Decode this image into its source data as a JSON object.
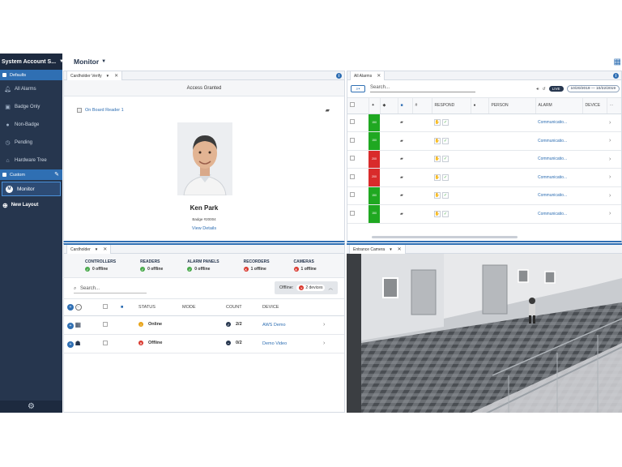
{
  "sidebar": {
    "account": "System Account S...",
    "defaults_label": "Defaults",
    "items": [
      {
        "label": "All Alarms",
        "icon": "bell-icon"
      },
      {
        "label": "Badge Only",
        "icon": "badge-icon"
      },
      {
        "label": "Non-Badge",
        "icon": "person-icon"
      },
      {
        "label": "Pending",
        "icon": "clock-icon"
      },
      {
        "label": "Hardware Tree",
        "icon": "tree-icon"
      }
    ],
    "custom_label": "Custom",
    "monitor_label": "Monitor",
    "new_layout_label": "New Layout"
  },
  "header": {
    "title": "Monitor"
  },
  "cardholder_verify": {
    "tab": "Cardholder Verify",
    "status": "Access Granted",
    "reader": "On Board Reader 1",
    "name": "Ken Park",
    "badge": "Badge #20004",
    "view_details": "View Details"
  },
  "alarms": {
    "tab": "All Alarms",
    "search_placeholder": "Search...",
    "live": "LIVE",
    "date_range": "10/20/2019 — 10/22/2019",
    "columns": [
      "",
      "",
      "",
      "",
      "#",
      "RESPOND",
      "",
      "PERSON",
      "ALARM",
      "DEVICE"
    ],
    "rows": [
      {
        "priority": "150",
        "color": "#1fa821",
        "alarm": "Communicatio..."
      },
      {
        "priority": "150",
        "color": "#1fa821",
        "alarm": "Communicatio..."
      },
      {
        "priority": "200",
        "color": "#d92b2b",
        "alarm": "Communicatio..."
      },
      {
        "priority": "200",
        "color": "#d92b2b",
        "alarm": "Communicatio..."
      },
      {
        "priority": "150",
        "color": "#1fa821",
        "alarm": "Communicatio..."
      },
      {
        "priority": "150",
        "color": "#1fa821",
        "alarm": "Communicatio..."
      }
    ]
  },
  "cardholder": {
    "tab": "Cardholder",
    "stats": [
      {
        "label": "CONTROLLERS",
        "value": "0 offline",
        "state": "ok"
      },
      {
        "label": "READERS",
        "value": "0 offline",
        "state": "ok"
      },
      {
        "label": "ALARM PANELS",
        "value": "0 offline",
        "state": "ok"
      },
      {
        "label": "RECORDERS",
        "value": "1 offline",
        "state": "bad"
      },
      {
        "label": "CAMERAS",
        "value": "1 offline",
        "state": "bad"
      }
    ],
    "search_placeholder": "Search...",
    "offline_label": "Offline:",
    "offline_count": "2 devices",
    "columns": {
      "status": "STATUS",
      "mode": "MODE",
      "count": "COUNT",
      "device": "DEVICE"
    },
    "rows": [
      {
        "status": "Online",
        "count": "2/2",
        "device": "AWS Demo"
      },
      {
        "status": "Offline",
        "count": "0/2",
        "device": "Demo Video"
      }
    ]
  },
  "camera": {
    "tab": "Entrance Camera"
  },
  "colors": {
    "accent": "#2f6fb3",
    "sidebar": "#26364e"
  }
}
